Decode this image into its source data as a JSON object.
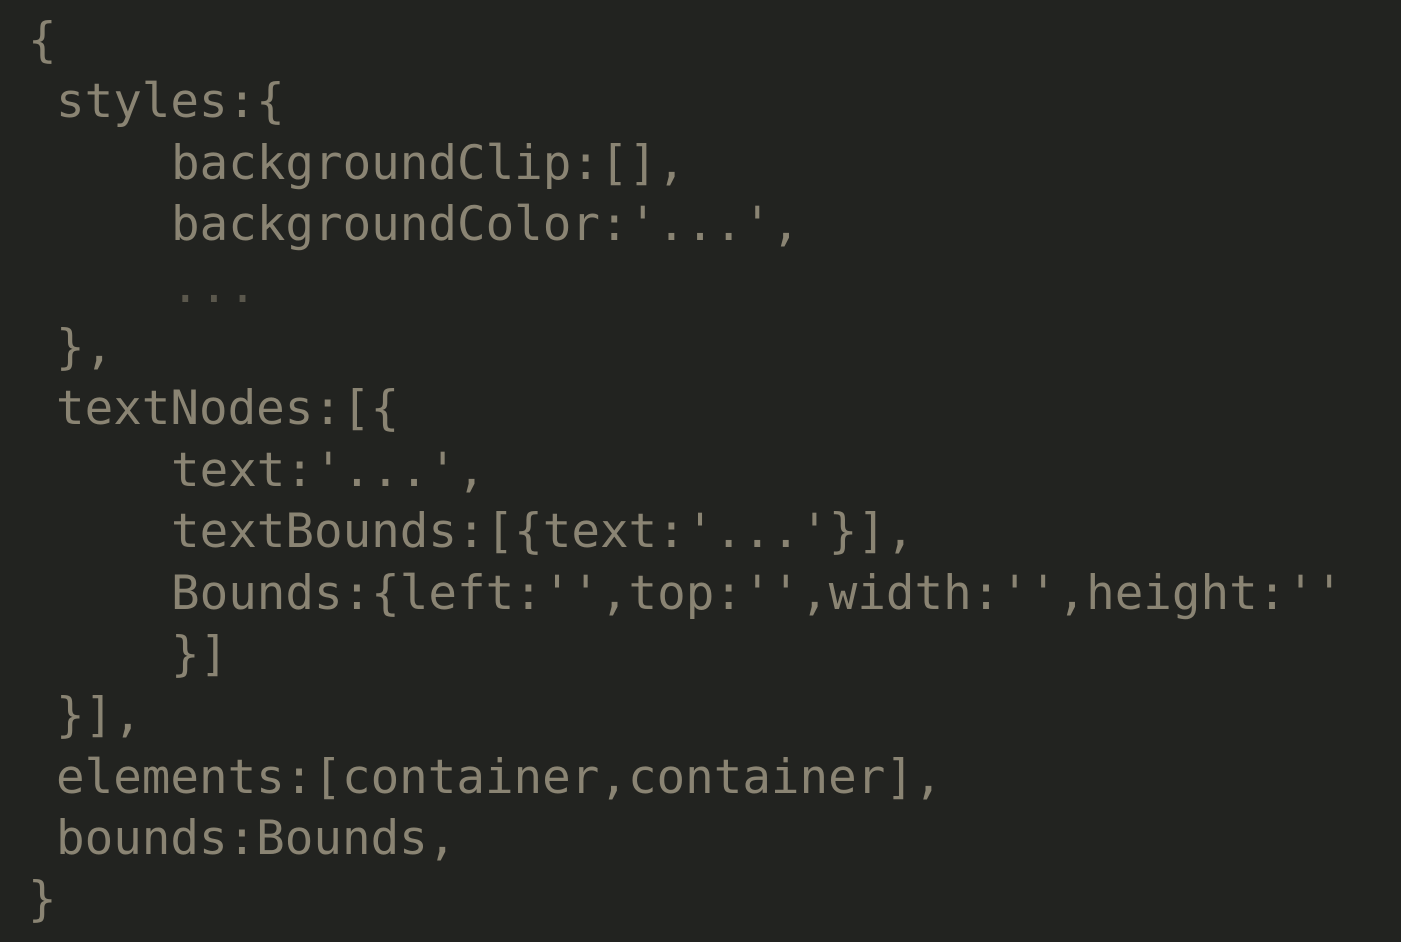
{
  "colors": {
    "background": "#222320",
    "text": "#8a8473",
    "ellipsis": "#5a574c"
  },
  "code_lines": [
    "{",
    "styles:{",
    "backgroundClip:[],",
    "backgroundColor:'...',",
    "...",
    "},",
    "textNodes:[{",
    "text:'...',",
    "textBounds:[{text:'...'}],",
    "Bounds:{left:'',top:'',width:'',height:''",
    "}]",
    "}],",
    "elements:[container,container],",
    "bounds:Bounds,",
    "}"
  ]
}
